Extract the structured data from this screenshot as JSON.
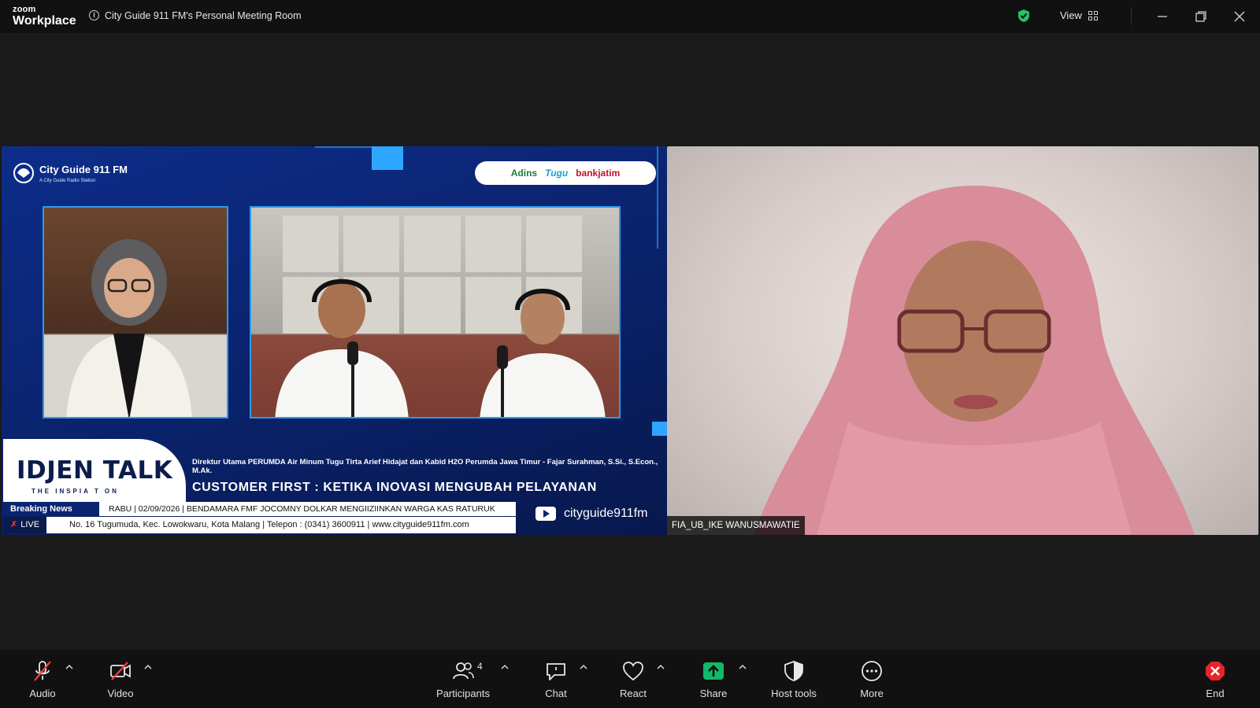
{
  "titlebar": {
    "brand_small": "zoom",
    "brand_large": "Workplace",
    "meeting_title": "City Guide 911 FM's Personal Meeting Room",
    "view_label": "View"
  },
  "left_tile": {
    "station_name": "City Guide 911 FM",
    "station_sub": "A City Guide Radio Station",
    "sponsors": [
      "Adins",
      "Tugu",
      "bankjatim"
    ],
    "show_title": "IDJEN TALK",
    "show_sub": "THE INSPIA T ON",
    "guests": "Direktur Utama PERUMDA Air Minum Tugu Tirta Arief Hidajat dan Kabid H2O Perumda Jawa Timur - Fajar Surahman, S.Si., S.Econ., M.Ak.",
    "headline": "CUSTOMER FIRST : KETIKA INOVASI MENGUBAH PELAYANAN",
    "breaking_label": "Breaking News",
    "breaking_text": "RABU | 02/09/2026 | BENDAMARA FMF JOCOMNY DOLKAR MENGIIZIINKAN WARGA KAS RATURUK",
    "live_label": "LIVE",
    "address": "No. 16 Tugumuda, Kec. Lowokwaru, Kota Malang | Telepon : (0341) 3600911 | www.cityguide911fm.com",
    "youtube": "cityguide911fm"
  },
  "right_tile": {
    "participant_name": "FIA_UB_IKE WANUSMAWATIE"
  },
  "toolbar": {
    "audio": "Audio",
    "video": "Video",
    "participants": "Participants",
    "participants_count": "4",
    "chat": "Chat",
    "react": "React",
    "share": "Share",
    "host_tools": "Host tools",
    "more": "More",
    "end": "End"
  },
  "colors": {
    "share_green": "#12b76a",
    "end_red": "#e5252b",
    "secure_green": "#22c55e",
    "stage_blue": "#0b2470"
  }
}
